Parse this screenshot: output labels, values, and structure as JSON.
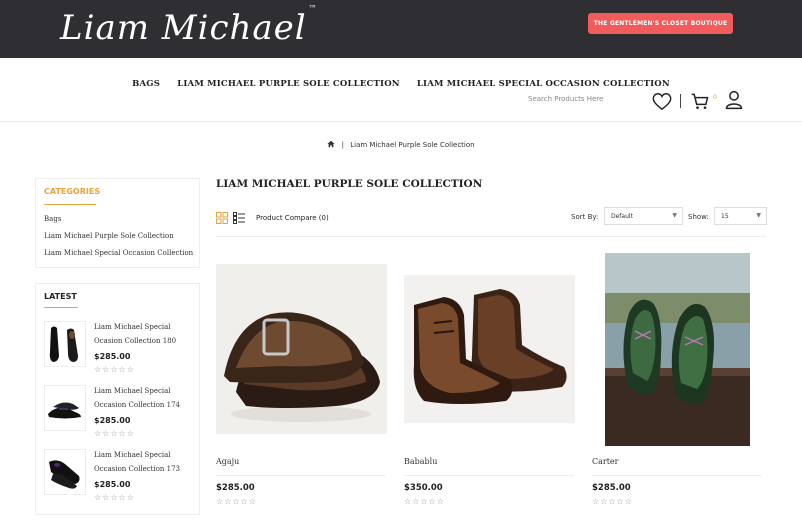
{
  "header": {
    "logo_text": "Liam Michael",
    "logo_tm": "™",
    "boutique_button": "THE GENTLEMEN'S CLOSET BOUTIQUE"
  },
  "nav": {
    "links": [
      "BAGS",
      "LIAM MICHAEL PURPLE SOLE COLLECTION",
      "LIAM MICHAEL SPECIAL OCCASION COLLECTION"
    ],
    "search_placeholder": "Search Products Here",
    "cart_count": "0"
  },
  "breadcrumb": {
    "home_icon": "home-icon",
    "separator": "|",
    "current": "Liam Michael Purple Sole Collection"
  },
  "sidebar": {
    "categories_title": "CATEGORIES",
    "categories": [
      "Bags",
      "Liam Michael Purple Sole Collection",
      "Liam Michael Special Occasion Collection"
    ],
    "latest_title": "LATEST",
    "latest": [
      {
        "name": "Liam Michael Special Ocasion Collection 180",
        "price": "$285.00",
        "rating": 0
      },
      {
        "name": "Liam Michael Special Occasion Collection 174",
        "price": "$285.00",
        "rating": 0
      },
      {
        "name": "Liam Michael Special Occasion Collection 173",
        "price": "$285.00",
        "rating": 0
      }
    ]
  },
  "main": {
    "title": "LIAM MICHAEL PURPLE SOLE COLLECTION",
    "compare_label": "Product Compare (0)",
    "sort_label": "Sort By:",
    "sort_value": "Default",
    "show_label": "Show:",
    "show_value": "15",
    "products": [
      {
        "name": "Agaju",
        "price": "$285.00",
        "rating": 0
      },
      {
        "name": "Babablu",
        "price": "$350.00",
        "rating": 0
      },
      {
        "name": "Carter",
        "price": "$285.00",
        "rating": 0
      }
    ]
  },
  "colors": {
    "header_bg": "#2f2f33",
    "accent_orange": "#e8a33a",
    "button_red": "#f05b5b"
  }
}
